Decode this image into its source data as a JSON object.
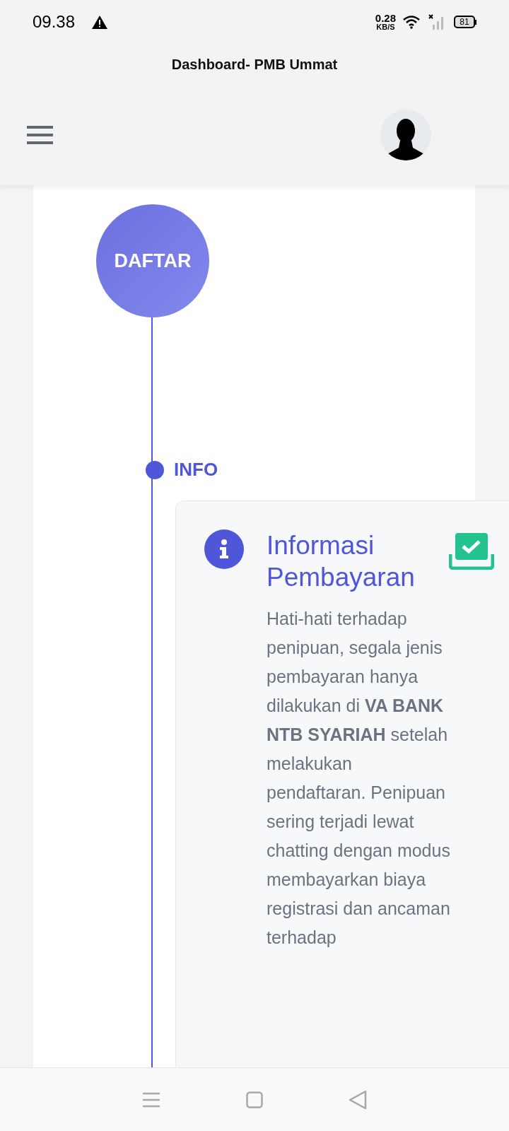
{
  "status_bar": {
    "time": "09.38",
    "speed_value": "0.28",
    "speed_unit": "KB/S",
    "battery": "81"
  },
  "window": {
    "title": "Dashboard- PMB Ummat"
  },
  "timeline": {
    "start_label": "DAFTAR",
    "step_label": "INFO",
    "card": {
      "title": "Informasi Pembayaran",
      "body": "Hati-hati terhadap penipuan, segala jenis pembayaran hanya dilakukan di **VA BANK NTB SYARIAH** setelah melakukan pendaftaran. Penipuan sering terjadi lewat chatting dengan modus membayarkan biaya registrasi dan ancaman terhadap"
    }
  }
}
